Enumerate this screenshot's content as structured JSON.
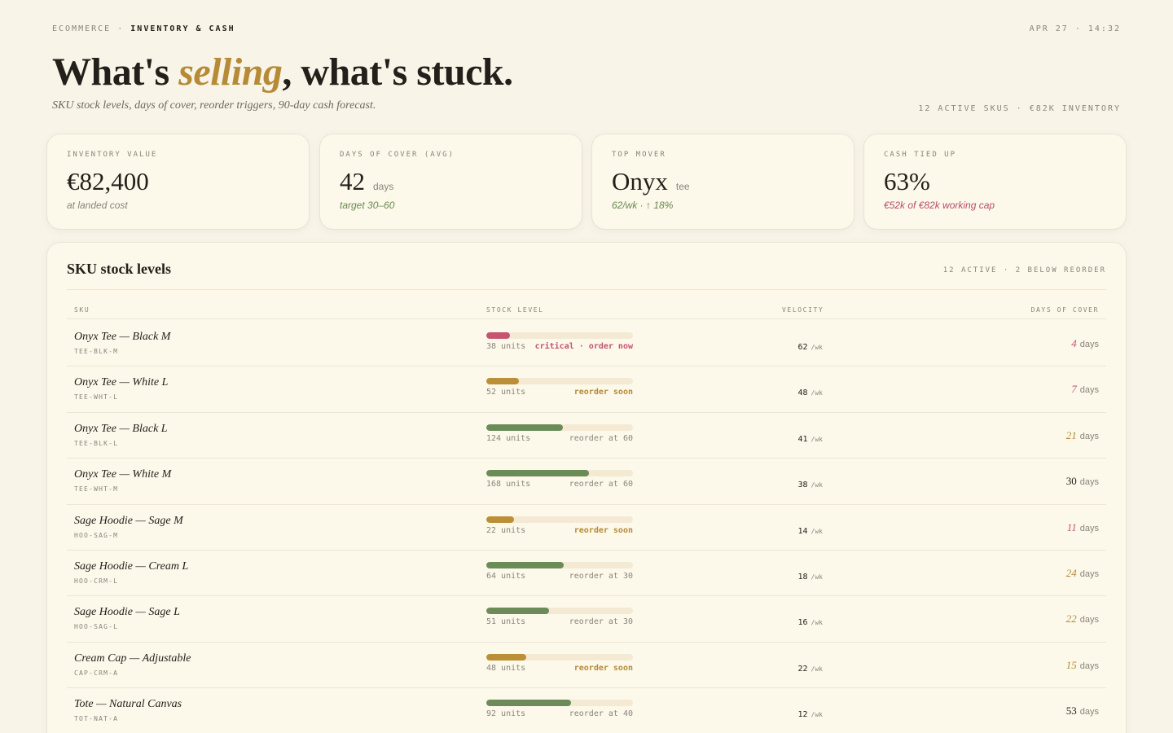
{
  "topbar": {
    "section": "ECOMMERCE",
    "separator": "·",
    "page": "INVENTORY & CASH",
    "date": "APR 27",
    "time": "14:32"
  },
  "header": {
    "title_before": "What's ",
    "title_accent": "selling",
    "title_after": ", what's stuck.",
    "subtitle": "SKU stock levels, days of cover, reorder triggers, 90-day cash forecast.",
    "summary": "12 ACTIVE SKUS · €82K INVENTORY"
  },
  "kpis": [
    {
      "label": "INVENTORY VALUE",
      "value": "€82,400",
      "unit": "",
      "note": "at landed cost",
      "note_tone": "muted"
    },
    {
      "label": "DAYS OF COVER (AVG)",
      "value": "42",
      "unit": "days",
      "note": "target 30–60",
      "note_tone": "green"
    },
    {
      "label": "TOP MOVER",
      "value": "Onyx",
      "unit": "tee",
      "note": "62/wk · ↑ 18%",
      "note_tone": "green"
    },
    {
      "label": "CASH TIED UP",
      "value": "63%",
      "unit": "",
      "note": "€52k of €82k working cap",
      "note_tone": "red"
    }
  ],
  "table": {
    "title": "SKU stock levels",
    "meta": "12 ACTIVE · 2 BELOW REORDER",
    "columns": {
      "sku": "SKU",
      "stock": "STOCK LEVEL",
      "velocity": "VELOCITY",
      "cover": "DAYS OF COVER"
    },
    "velocity_unit": "/wk",
    "cover_unit": "days",
    "rows": [
      {
        "name": "Onyx Tee — Black M",
        "code": "TEE-BLK-M",
        "units": "38 units",
        "level": 0.16,
        "tone": "critical",
        "status": "critical · order now",
        "velocity": "62",
        "cover": "4",
        "cover_tone": "red"
      },
      {
        "name": "Onyx Tee — White L",
        "code": "TEE-WHT-L",
        "units": "52 units",
        "level": 0.22,
        "tone": "warn",
        "status": "reorder soon",
        "velocity": "48",
        "cover": "7",
        "cover_tone": "red"
      },
      {
        "name": "Onyx Tee — Black L",
        "code": "TEE-BLK-L",
        "units": "124 units",
        "level": 0.52,
        "tone": "ok",
        "status": "reorder at 60",
        "velocity": "41",
        "cover": "21",
        "cover_tone": "amber"
      },
      {
        "name": "Onyx Tee — White M",
        "code": "TEE-WHT-M",
        "units": "168 units",
        "level": 0.7,
        "tone": "ok",
        "status": "reorder at 60",
        "velocity": "38",
        "cover": "30",
        "cover_tone": "dark"
      },
      {
        "name": "Sage Hoodie — Sage M",
        "code": "HOO-SAG-M",
        "units": "22 units",
        "level": 0.19,
        "tone": "warn",
        "status": "reorder soon",
        "velocity": "14",
        "cover": "11",
        "cover_tone": "red"
      },
      {
        "name": "Sage Hoodie — Cream L",
        "code": "HOO-CRM-L",
        "units": "64 units",
        "level": 0.53,
        "tone": "ok",
        "status": "reorder at 30",
        "velocity": "18",
        "cover": "24",
        "cover_tone": "amber"
      },
      {
        "name": "Sage Hoodie — Sage L",
        "code": "HOO-SAG-L",
        "units": "51 units",
        "level": 0.43,
        "tone": "ok",
        "status": "reorder at 30",
        "velocity": "16",
        "cover": "22",
        "cover_tone": "amber"
      },
      {
        "name": "Cream Cap — Adjustable",
        "code": "CAP-CRM-A",
        "units": "48 units",
        "level": 0.27,
        "tone": "warn",
        "status": "reorder soon",
        "velocity": "22",
        "cover": "15",
        "cover_tone": "amber"
      },
      {
        "name": "Tote — Natural Canvas",
        "code": "TOT-NAT-A",
        "units": "92 units",
        "level": 0.58,
        "tone": "ok",
        "status": "reorder at 40",
        "velocity": "12",
        "cover": "53",
        "cover_tone": "dark"
      }
    ]
  },
  "colors": {
    "background": "#f8f4e8",
    "card": "#fcf8ea",
    "accent": "#b68a36",
    "critical": "#c4546f",
    "warn": "#bb8f37",
    "ok": "#6b8c58"
  }
}
